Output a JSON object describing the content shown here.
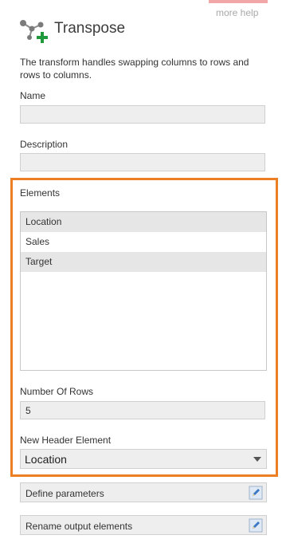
{
  "header": {
    "help_link": "more help",
    "title": "Transpose",
    "title_icon": "transpose-add-icon"
  },
  "description": "The transform handles swapping columns to rows and rows to columns.",
  "name_field": {
    "label": "Name",
    "value": ""
  },
  "description_field": {
    "label": "Description",
    "value": ""
  },
  "elements": {
    "label": "Elements",
    "items": [
      "Location",
      "Sales",
      "Target"
    ],
    "selected": [
      "Location",
      "Target"
    ]
  },
  "number_of_rows": {
    "label": "Number Of Rows",
    "value": "5"
  },
  "new_header_element": {
    "label": "New Header Element",
    "selected": "Location"
  },
  "actions": [
    {
      "label": "Define parameters",
      "icon": "edit-icon"
    },
    {
      "label": "Rename output elements",
      "icon": "edit-icon"
    }
  ],
  "colors": {
    "highlight": "#ec7e24",
    "accent_green": "#1e9a3c",
    "field_bg": "#eeeeee"
  }
}
